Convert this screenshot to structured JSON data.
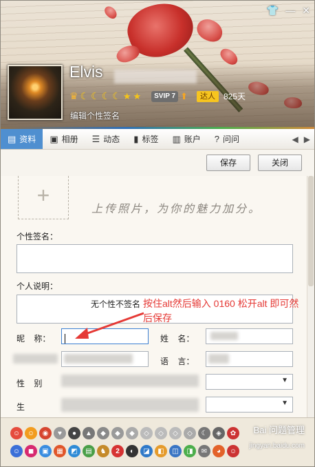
{
  "window": {
    "top_icons": [
      "shirt-icon",
      "minimize-icon",
      "close-icon"
    ]
  },
  "profile": {
    "nickname": "Elvis",
    "sign_edit": "编辑个性签名",
    "svip": "SVIP 7",
    "talent": "达人",
    "days": "825天"
  },
  "tabs": [
    {
      "label": "资料",
      "icon": "profile-card-icon",
      "active": true
    },
    {
      "label": "相册",
      "icon": "photo-icon"
    },
    {
      "label": "动态",
      "icon": "list-icon"
    },
    {
      "label": "标签",
      "icon": "bookmark-icon"
    },
    {
      "label": "账户",
      "icon": "briefcase-icon"
    },
    {
      "label": "问问",
      "icon": "question-icon"
    }
  ],
  "buttons": {
    "save": "保存",
    "close": "关闭"
  },
  "upload": {
    "tip": "上传照片，为你的魅力加分。",
    "plus": "+"
  },
  "form": {
    "signature_label": "个性签名：",
    "intro_label": "个人说明：",
    "intro_value": "无个性不签名",
    "nickname_label": "昵    称：",
    "name_label": "姓    名：",
    "language_label": "语    言：",
    "gender_label": "性    别",
    "birth_label": "生"
  },
  "annotation": "按住alt然后输入 0160 松开alt 即可然后保存",
  "watermark": {
    "text": "Bai 问题管理",
    "url": "jingyan.baidu.com"
  },
  "colors": {
    "tab_active": "#4f8fd0",
    "annotation": "#e53935"
  }
}
